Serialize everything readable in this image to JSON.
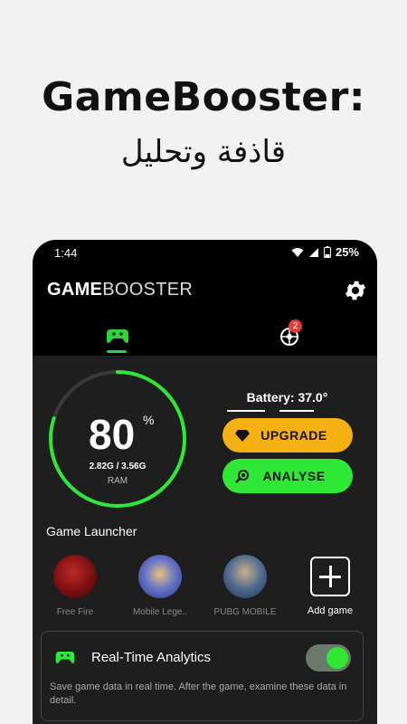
{
  "promo": {
    "title": "GameBooster:",
    "subtitle": "قاذفة وتحليل"
  },
  "status_bar": {
    "time": "1:44",
    "battery": "25%"
  },
  "app_bar": {
    "logo_bold": "GAME",
    "logo_light": "BOOSTER",
    "tabs": [
      {
        "icon": "gamepad-icon",
        "active": true
      },
      {
        "icon": "analytics-icon",
        "badge": "2"
      }
    ]
  },
  "ram": {
    "percent": "80",
    "percent_sign": "%",
    "usage": "2.82G / 3.56G",
    "label": "RAM",
    "fill_fraction": 0.8
  },
  "battery": {
    "text": "Battery: 37.0°"
  },
  "buttons": {
    "upgrade": "UPGRADE",
    "analyse": "ANALYSE"
  },
  "launcher": {
    "title": "Game Launcher",
    "games": [
      {
        "name": "Free Fire"
      },
      {
        "name": "Mobile Lege.."
      },
      {
        "name": "PUBG MOBILE"
      }
    ],
    "add_label": "Add game"
  },
  "analytics_card": {
    "title": "Real-Time Analytics",
    "enabled": true,
    "description": "Save game data in real time. After the game, examine these data in detail."
  },
  "colors": {
    "accent_green": "#2ee835",
    "accent_yellow": "#f5b112",
    "badge_red": "#e53935",
    "background": "#1e1e1e"
  }
}
